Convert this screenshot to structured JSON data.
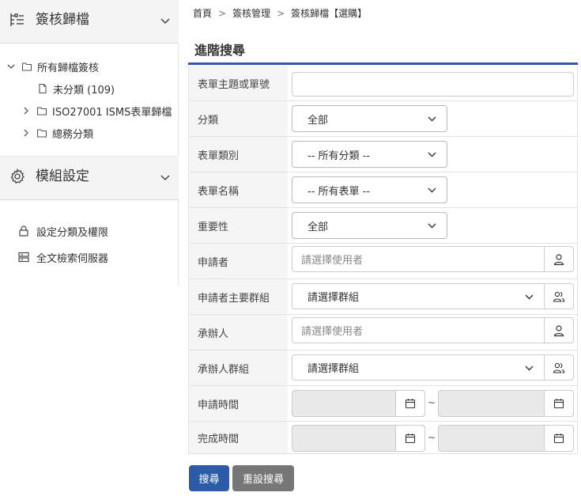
{
  "sidebar": {
    "archive_title": "簽核歸檔",
    "archive_icon": "tree-list-icon",
    "tree": [
      {
        "label": "所有歸檔簽核",
        "expanded": true
      },
      {
        "label": "未分類 (109)"
      },
      {
        "label": "ISO27001 ISMS表單歸檔",
        "expanded": false
      },
      {
        "label": "總務分類",
        "expanded": false
      }
    ],
    "module_title": "模組設定",
    "module_icon": "gear-icon",
    "links": [
      {
        "label": "設定分類及權限",
        "icon": "lock-icon"
      },
      {
        "label": "全文檢索伺服器",
        "icon": "server-icon"
      }
    ]
  },
  "breadcrumb": [
    "首頁",
    "簽核管理",
    "簽核歸檔【選購】"
  ],
  "section_title": "進階搜尋",
  "accent_color": "#2c5ba8",
  "form": {
    "subject_label": "表單主題或單號",
    "subject_value": "",
    "category_label": "分類",
    "category_value": "全部",
    "form_type_label": "表單類別",
    "form_type_value": "-- 所有分類 --",
    "form_name_label": "表單名稱",
    "form_name_value": "-- 所有表單 --",
    "importance_label": "重要性",
    "importance_value": "全部",
    "applicant_label": "申請者",
    "applicant_placeholder": "請選擇使用者",
    "applicant_group_label": "申請者主要群組",
    "applicant_group_value": "請選擇群組",
    "handler_label": "承辦人",
    "handler_placeholder": "請選擇使用者",
    "handler_group_label": "承辦人群組",
    "handler_group_value": "請選擇群組",
    "apply_time_label": "申請時間",
    "finish_time_label": "完成時間",
    "range_sep": "~"
  },
  "buttons": {
    "search": "搜尋",
    "reset": "重設搜尋"
  }
}
